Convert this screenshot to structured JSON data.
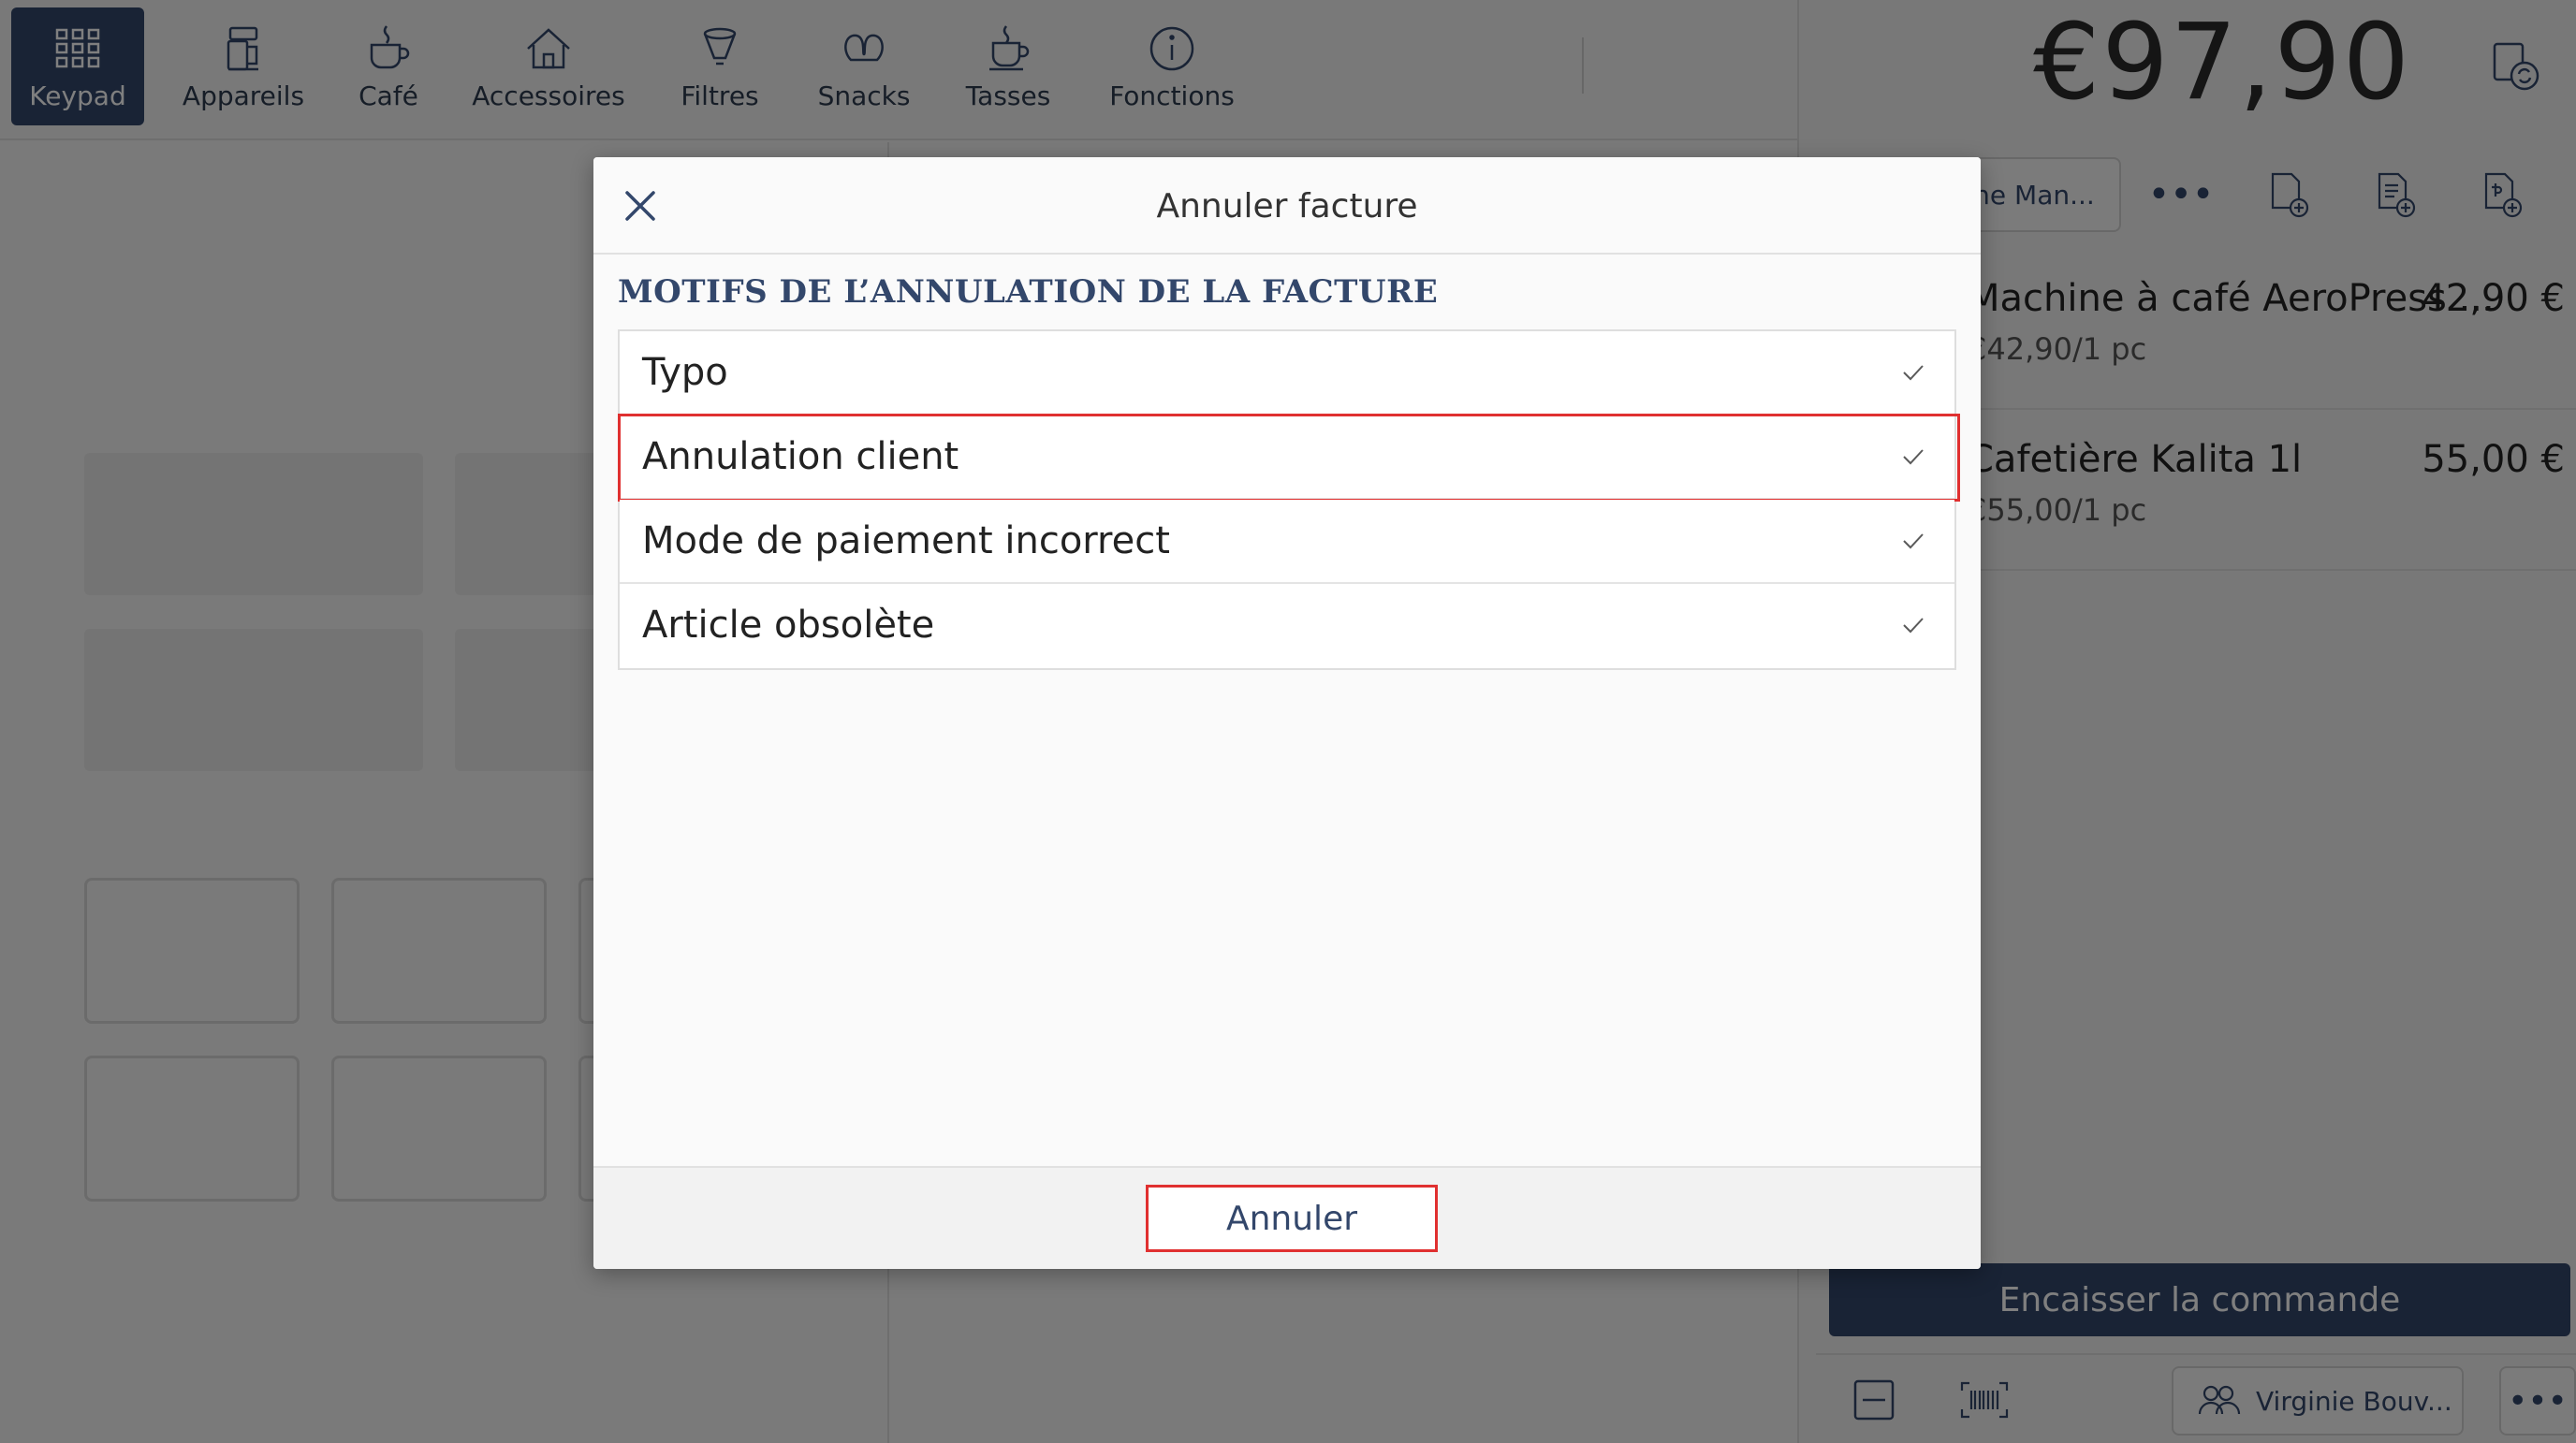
{
  "categories": [
    {
      "label": "Keypad",
      "icon": "keypad-icon",
      "active": true
    },
    {
      "label": "Appareils",
      "icon": "appliances-icon"
    },
    {
      "label": "Café",
      "icon": "coffee-cup-icon"
    },
    {
      "label": "Accessoires",
      "icon": "home-icon"
    },
    {
      "label": "Filtres",
      "icon": "filter-icon"
    },
    {
      "label": "Snacks",
      "icon": "pretzel-icon"
    },
    {
      "label": "Tasses",
      "icon": "cup-icon"
    },
    {
      "label": "Fonctions",
      "icon": "info-icon"
    }
  ],
  "order": {
    "total": "€97,90",
    "customer_tab_label": "ne Man...",
    "items": [
      {
        "name": "Machine à café AeroPress ...",
        "unit_price": "€42,90/1 pc",
        "price": "42,90 €"
      },
      {
        "name": "Cafetière Kalita 1l",
        "unit_price": "€55,00/1 pc",
        "price": "55,00 €"
      }
    ],
    "checkout_label": "Encaisser la commande",
    "cashier": "Virginie Bouv..."
  },
  "modal": {
    "title": "Annuler facture",
    "section_title": "MOTIFS DE L’ANNULATION DE LA FACTURE",
    "reasons": [
      {
        "label": "Typo"
      },
      {
        "label": "Annulation client",
        "highlighted": true
      },
      {
        "label": "Mode de paiement incorrect"
      },
      {
        "label": "Article obsolète"
      }
    ],
    "cancel_label": "Annuler"
  },
  "colors": {
    "brand": "#33476b",
    "highlight": "#e03030"
  }
}
